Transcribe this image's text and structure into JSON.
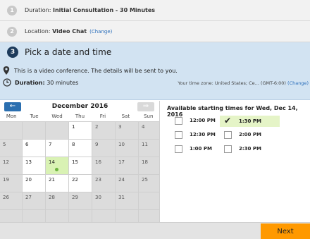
{
  "steps": {
    "step1": {
      "num": "1",
      "prefix": "Duration: ",
      "value": "Initial Consultation - 30 Minutes"
    },
    "step2": {
      "num": "2",
      "prefix": "Location: ",
      "value": "Video Chat",
      "change": "(Change)"
    },
    "step3": {
      "num": "3",
      "title": "Pick a date and time",
      "info": "This is a video conference. The details will be sent to you.",
      "duration_label": "Duration:",
      "duration_value": "30 minutes",
      "timezone": "Your time zone: United States; Ce... (GMT-6:00)",
      "timezone_change": "(Change)"
    }
  },
  "calendar": {
    "month": "December 2016",
    "prev_icon": "←",
    "next_icon": "⇒",
    "dow": [
      "Mon",
      "Tue",
      "Wed",
      "Thu",
      "Fri",
      "Sat",
      "Sun"
    ],
    "cells": [
      {
        "d": "",
        "s": "x"
      },
      {
        "d": "",
        "s": "x"
      },
      {
        "d": "",
        "s": "x"
      },
      {
        "d": "1",
        "s": "a"
      },
      {
        "d": "2",
        "s": "x"
      },
      {
        "d": "3",
        "s": "x"
      },
      {
        "d": "4",
        "s": "x"
      },
      {
        "d": "5",
        "s": "x"
      },
      {
        "d": "6",
        "s": "a"
      },
      {
        "d": "7",
        "s": "a"
      },
      {
        "d": "8",
        "s": "a"
      },
      {
        "d": "9",
        "s": "x"
      },
      {
        "d": "10",
        "s": "x"
      },
      {
        "d": "11",
        "s": "x"
      },
      {
        "d": "12",
        "s": "x"
      },
      {
        "d": "13",
        "s": "a"
      },
      {
        "d": "14",
        "s": "s"
      },
      {
        "d": "15",
        "s": "a"
      },
      {
        "d": "16",
        "s": "x"
      },
      {
        "d": "17",
        "s": "x"
      },
      {
        "d": "18",
        "s": "x"
      },
      {
        "d": "19",
        "s": "x"
      },
      {
        "d": "20",
        "s": "a"
      },
      {
        "d": "21",
        "s": "a"
      },
      {
        "d": "22",
        "s": "a"
      },
      {
        "d": "23",
        "s": "x"
      },
      {
        "d": "24",
        "s": "x"
      },
      {
        "d": "25",
        "s": "x"
      },
      {
        "d": "26",
        "s": "x"
      },
      {
        "d": "27",
        "s": "x"
      },
      {
        "d": "28",
        "s": "x"
      },
      {
        "d": "29",
        "s": "x"
      },
      {
        "d": "30",
        "s": "x"
      },
      {
        "d": "31",
        "s": "x"
      },
      {
        "d": "",
        "s": "x"
      },
      {
        "d": "",
        "s": "x"
      },
      {
        "d": "",
        "s": "x"
      },
      {
        "d": "",
        "s": "x"
      },
      {
        "d": "",
        "s": "x"
      },
      {
        "d": "",
        "s": "x"
      },
      {
        "d": "",
        "s": "x"
      },
      {
        "d": "",
        "s": "x"
      }
    ]
  },
  "times": {
    "title": "Available starting times for Wed, Dec 14, 2016",
    "slots": [
      {
        "label": "12:00 PM",
        "checked": false
      },
      {
        "label": "1:30 PM",
        "checked": true
      },
      {
        "label": "12:30 PM",
        "checked": false
      },
      {
        "label": "2:00 PM",
        "checked": false
      },
      {
        "label": "1:00 PM",
        "checked": false
      },
      {
        "label": "2:30 PM",
        "checked": false
      }
    ]
  },
  "footer": {
    "next_label": "Next"
  },
  "colors": {
    "accent": "#2b6fb0",
    "next": "#ff9900",
    "selected_day": "#d9f2b4",
    "selected_time": "#e5f4c7",
    "step3_bg": "#d2e3f2"
  }
}
